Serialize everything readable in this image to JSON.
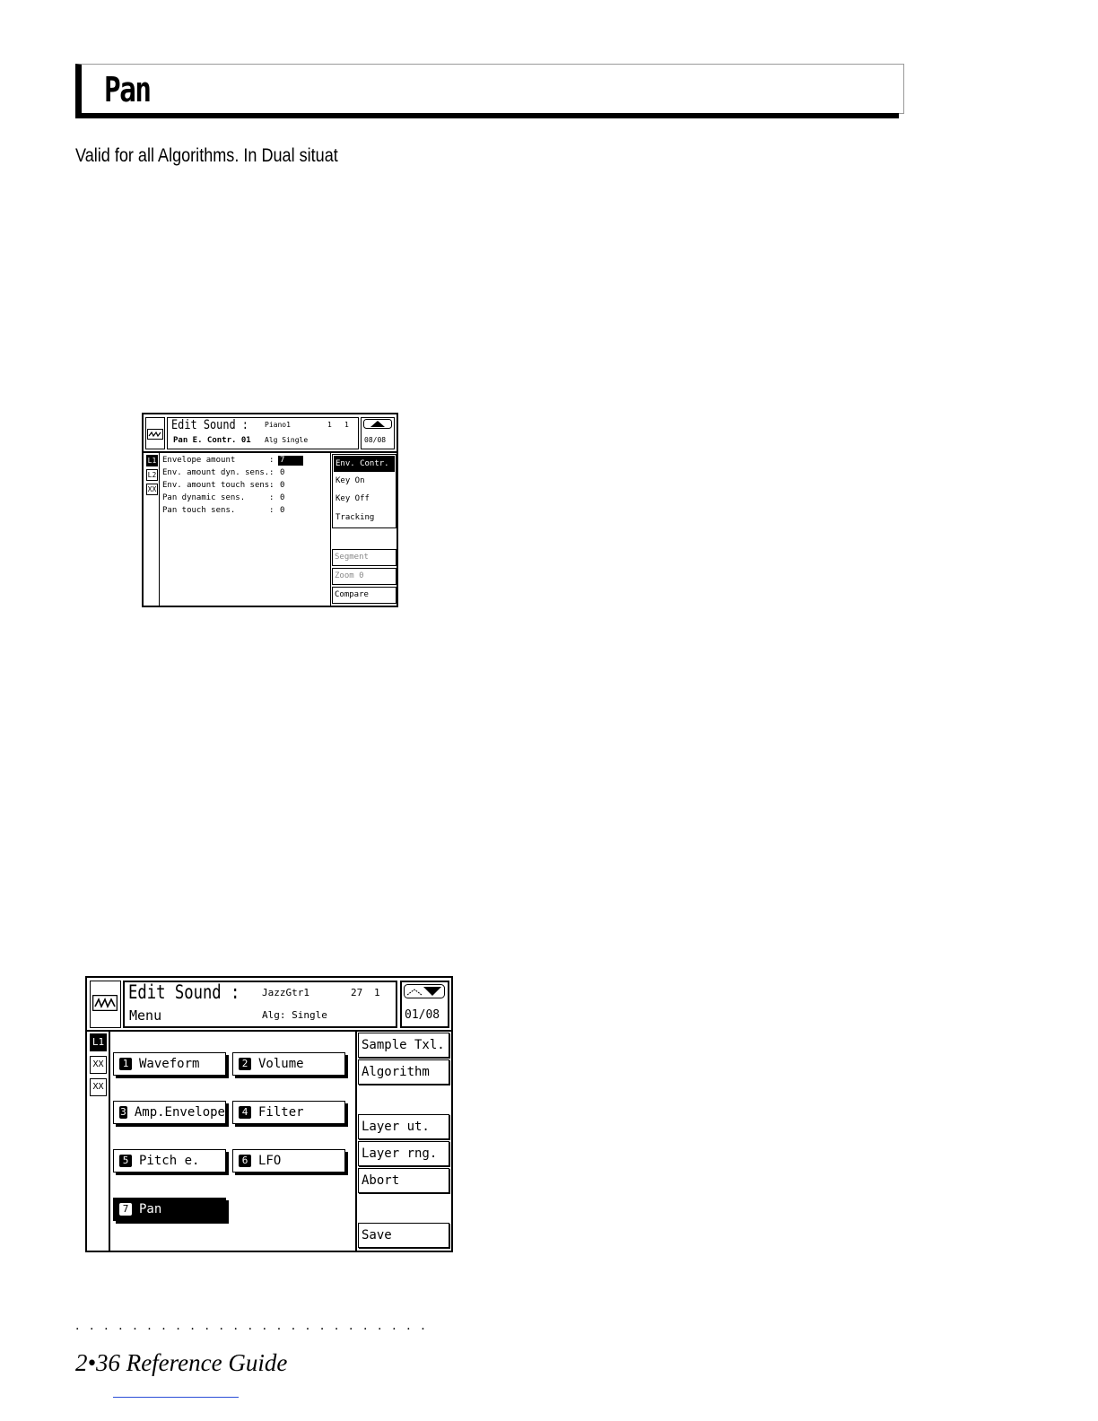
{
  "page": {
    "title": "Pan",
    "intro": "Valid for all Algorithms.  In Dual situat",
    "footer": "2•36   Reference Guide"
  },
  "screen1": {
    "title": "Edit Sound :",
    "subtitle": "Pan E. Contr. 01",
    "sound_name": "Piano1",
    "num_a": "1",
    "num_b": "1",
    "algorithm": "Alg Single",
    "page_counter": "08/08",
    "layers": [
      "L1",
      "L2",
      "XX"
    ],
    "params": [
      {
        "label": "Envelope amount",
        "value": "7"
      },
      {
        "label": "Env. amount dyn. sens.",
        "value": "0"
      },
      {
        "label": "Env. amount touch sens.",
        "value": "0"
      },
      {
        "label": "Pan dynamic sens.",
        "value": "0"
      },
      {
        "label": "Pan touch sens.",
        "value": "0"
      }
    ],
    "menu": [
      "Env. Contr.",
      "Key On",
      "Key Off",
      "Tracking"
    ],
    "buttons": [
      "Segment",
      "Zoom  0",
      "Compare"
    ]
  },
  "screen2": {
    "title": "Edit Sound :",
    "subtitle": "Menu",
    "sound_name": "JazzGtr1",
    "num_a": "27",
    "num_b": "1",
    "algorithm": "Alg: Single",
    "page_counter": "01/08",
    "layers": [
      "L1",
      "XX",
      "XX"
    ],
    "items": [
      {
        "n": "1",
        "label": "Waveform"
      },
      {
        "n": "2",
        "label": "Volume"
      },
      {
        "n": "3",
        "label": "Amp.Envelope"
      },
      {
        "n": "4",
        "label": "Filter"
      },
      {
        "n": "5",
        "label": "Pitch e."
      },
      {
        "n": "6",
        "label": "LFO"
      },
      {
        "n": "7",
        "label": "Pan"
      }
    ],
    "side_buttons": [
      "Sample Txl.",
      "Algorithm",
      "Layer ut.",
      "Layer rng.",
      "Abort",
      "Save"
    ]
  }
}
